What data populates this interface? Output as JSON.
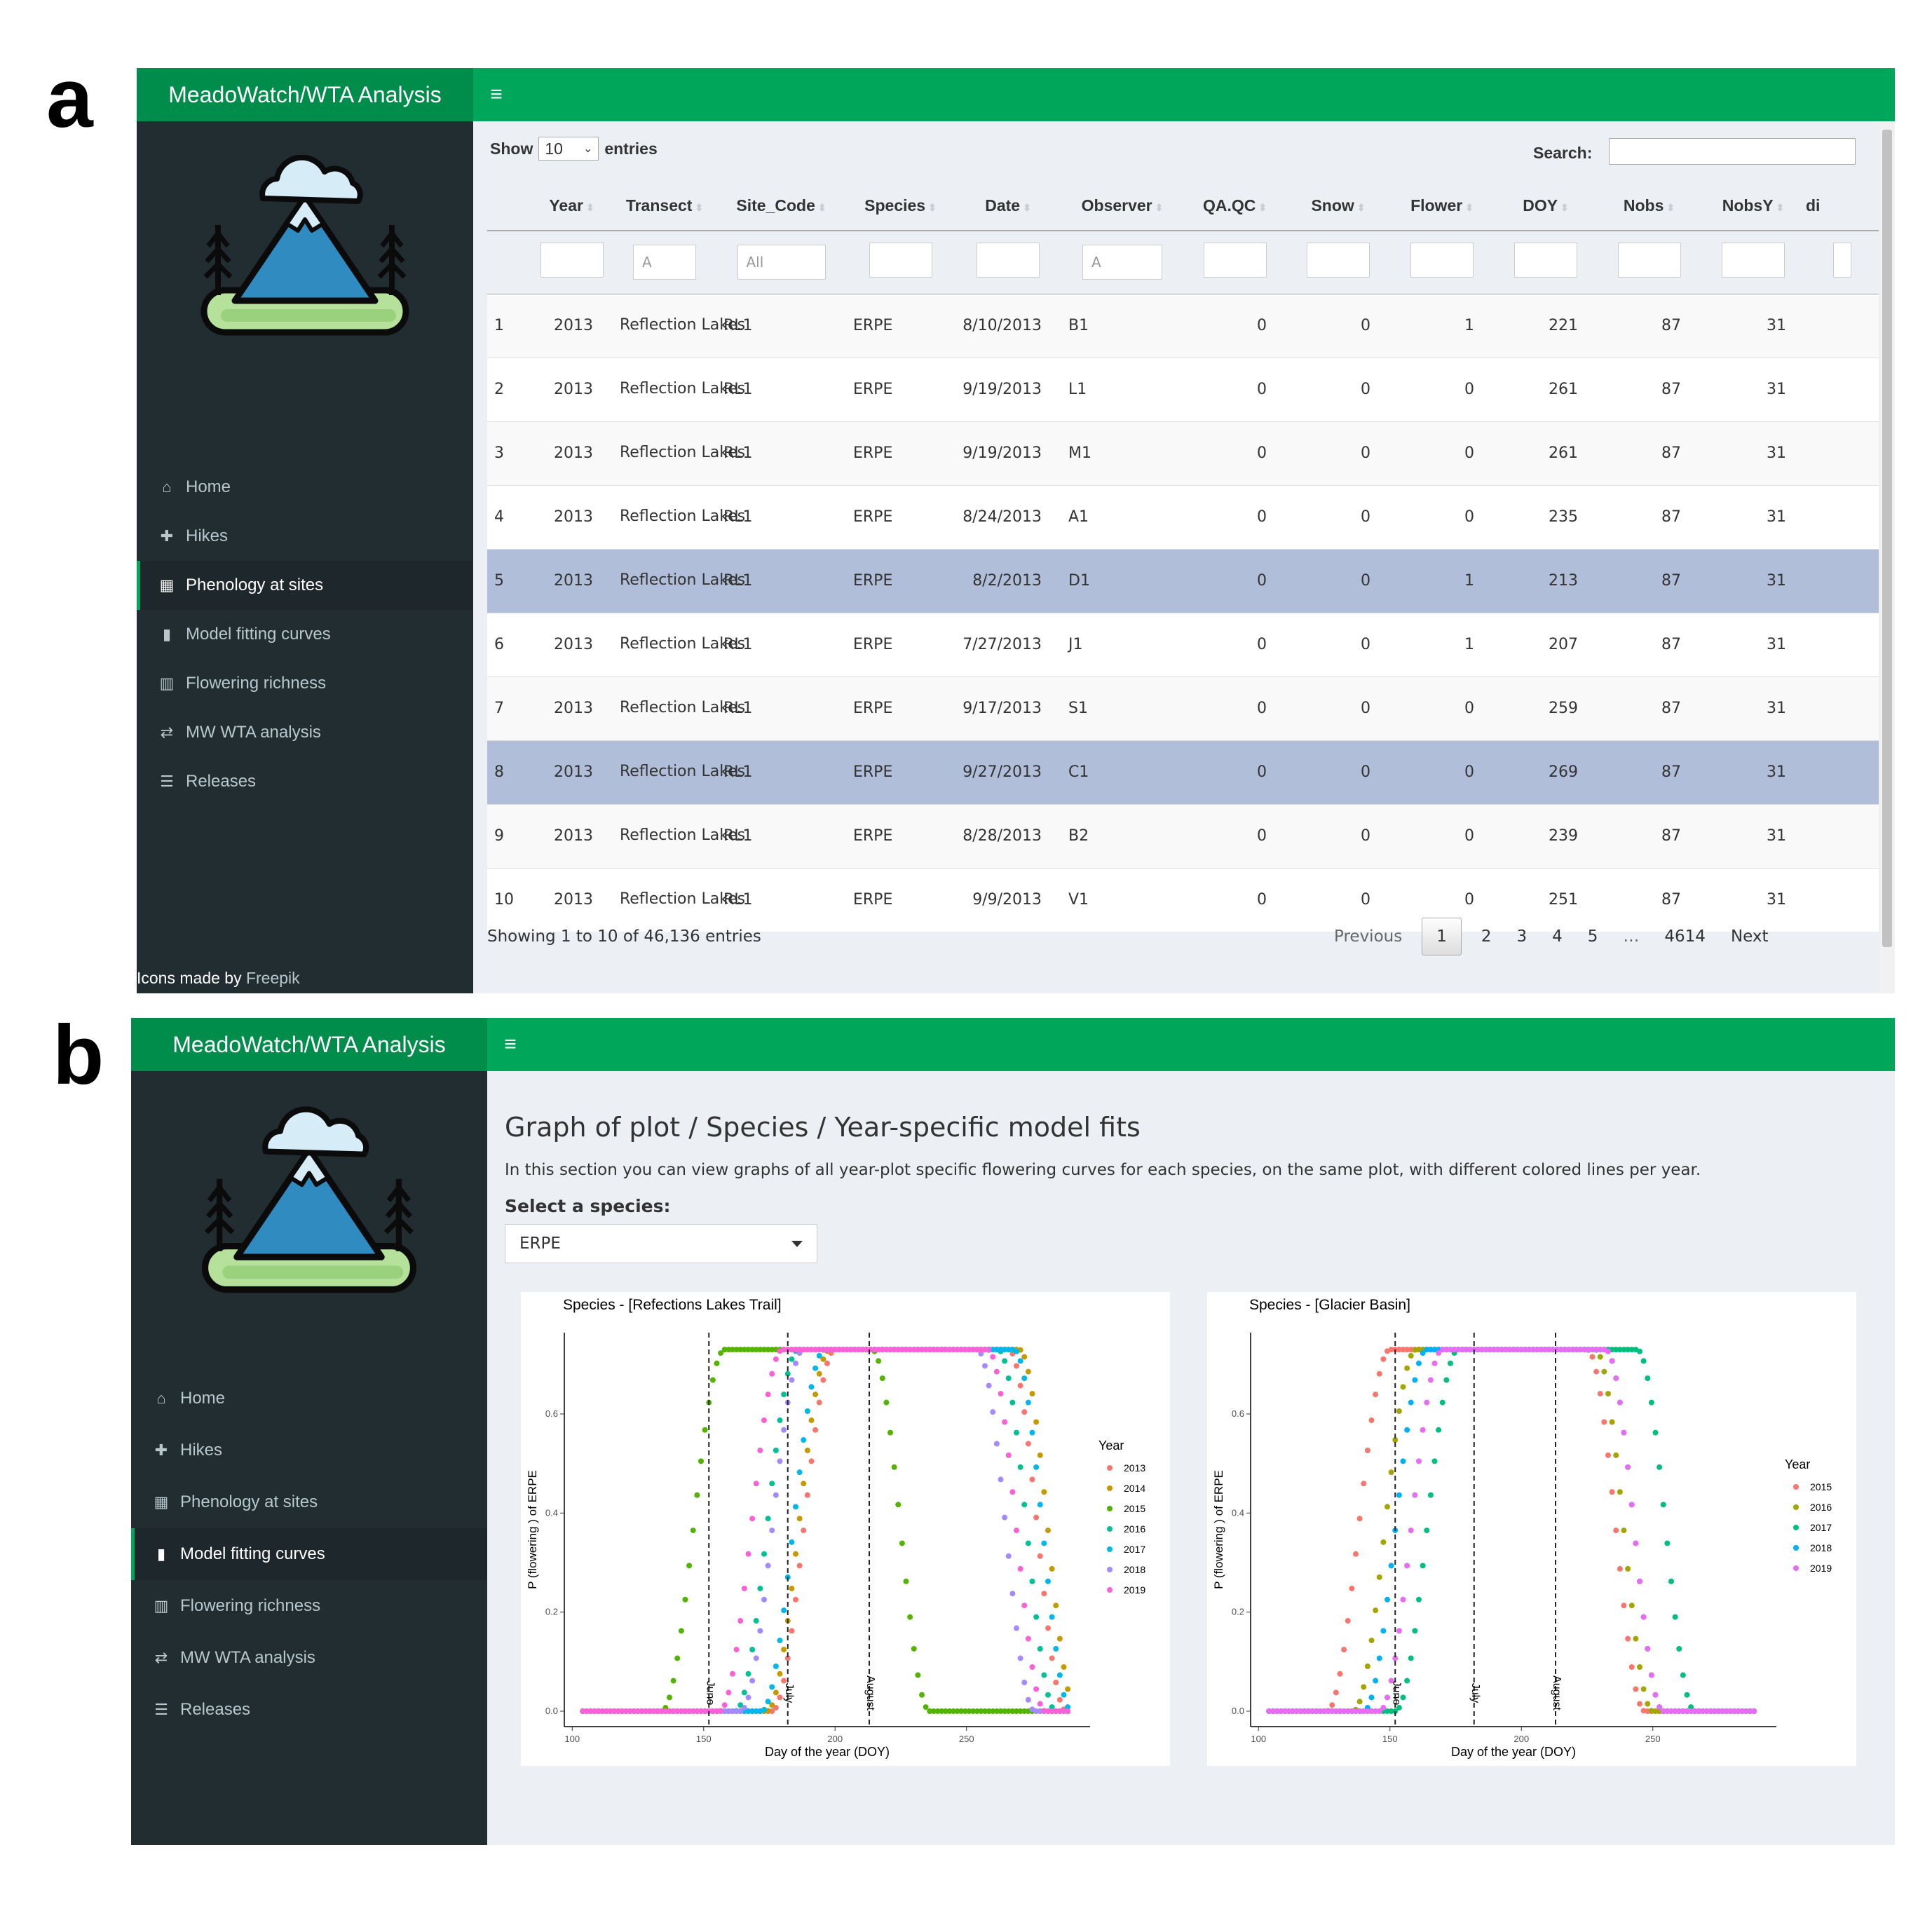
{
  "panels": {
    "a": "a",
    "b": "b"
  },
  "app": {
    "brand": "MeadoWatch/WTA Analysis"
  },
  "menu": [
    {
      "label": "Home",
      "icon": "home-icon"
    },
    {
      "label": "Hikes",
      "icon": "pin-icon"
    },
    {
      "label": "Phenology at sites",
      "icon": "table-icon"
    },
    {
      "label": "Model fitting curves",
      "icon": "bar-chart-icon"
    },
    {
      "label": "Flowering richness",
      "icon": "map-icon"
    },
    {
      "label": "MW WTA analysis",
      "icon": "random-icon"
    },
    {
      "label": "Releases",
      "icon": "list-icon"
    }
  ],
  "panel_a": {
    "active_menu": "Phenology at sites",
    "credit": {
      "prefix": "Icons made by ",
      "link": "Freepik"
    },
    "length": {
      "show": "Show",
      "value": "10",
      "entries": "entries"
    },
    "search_label": "Search:",
    "columns": [
      "",
      "Year",
      "Transect",
      "Site_Code",
      "Species",
      "Date",
      "Observer",
      "QA.QC",
      "Snow",
      "Flower",
      "DOY",
      "Nobs",
      "NobsY",
      "di"
    ],
    "filters": [
      "",
      "",
      "A",
      "All",
      "",
      "",
      "A",
      "",
      "",
      "",
      "",
      "",
      "",
      ""
    ],
    "rows": [
      [
        "1",
        "2013",
        "Reflection Lakes",
        "RL1",
        "ERPE",
        "8/10/2013",
        "B1",
        "0",
        "0",
        "1",
        "221",
        "87",
        "31"
      ],
      [
        "2",
        "2013",
        "Reflection Lakes",
        "RL1",
        "ERPE",
        "9/19/2013",
        "L1",
        "0",
        "0",
        "0",
        "261",
        "87",
        "31"
      ],
      [
        "3",
        "2013",
        "Reflection Lakes",
        "RL1",
        "ERPE",
        "9/19/2013",
        "M1",
        "0",
        "0",
        "0",
        "261",
        "87",
        "31"
      ],
      [
        "4",
        "2013",
        "Reflection Lakes",
        "RL1",
        "ERPE",
        "8/24/2013",
        "A1",
        "0",
        "0",
        "0",
        "235",
        "87",
        "31"
      ],
      [
        "5",
        "2013",
        "Reflection Lakes",
        "RL1",
        "ERPE",
        "8/2/2013",
        "D1",
        "0",
        "0",
        "1",
        "213",
        "87",
        "31"
      ],
      [
        "6",
        "2013",
        "Reflection Lakes",
        "RL1",
        "ERPE",
        "7/27/2013",
        "J1",
        "0",
        "0",
        "1",
        "207",
        "87",
        "31"
      ],
      [
        "7",
        "2013",
        "Reflection Lakes",
        "RL1",
        "ERPE",
        "9/17/2013",
        "S1",
        "0",
        "0",
        "0",
        "259",
        "87",
        "31"
      ],
      [
        "8",
        "2013",
        "Reflection Lakes",
        "RL1",
        "ERPE",
        "9/27/2013",
        "C1",
        "0",
        "0",
        "0",
        "269",
        "87",
        "31"
      ],
      [
        "9",
        "2013",
        "Reflection Lakes",
        "RL1",
        "ERPE",
        "8/28/2013",
        "B2",
        "0",
        "0",
        "0",
        "239",
        "87",
        "31"
      ],
      [
        "10",
        "2013",
        "Reflection Lakes",
        "RL1",
        "ERPE",
        "9/9/2013",
        "V1",
        "0",
        "0",
        "0",
        "251",
        "87",
        "31"
      ]
    ],
    "selected_rows": [
      5,
      8
    ],
    "info": "Showing 1 to 10 of 46,136 entries",
    "pagination": {
      "previous": "Previous",
      "pages": [
        "1",
        "2",
        "3",
        "4",
        "5",
        "…",
        "4614"
      ],
      "current": "1",
      "next": "Next"
    }
  },
  "panel_b": {
    "active_menu": "Model fitting curves",
    "heading": "Graph of plot / Species / Year-specific model fits",
    "description": "In this section you can view graphs of all year-plot specific flowering curves for each species, on the same plot, with different colored lines per year.",
    "select_label": "Select a species:",
    "select_value": "ERPE"
  },
  "colors": {
    "green": "#00a65a",
    "brand_green": "#008d4c",
    "sidebar": "#222d32",
    "selected_row": "#b0bed9"
  },
  "chart_data": [
    {
      "type": "scatter",
      "title": "Species - [Refections Lakes Trail]",
      "xlabel": "Day of the year (DOY)",
      "ylabel": "P (flowering ) of ERPE",
      "xlim": [
        100,
        290
      ],
      "ylim": [
        0,
        0.72
      ],
      "xticks": [
        100,
        150,
        200,
        250
      ],
      "yticks": [
        0.0,
        0.2,
        0.4,
        0.6
      ],
      "grid": false,
      "legend": {
        "title": "Year",
        "placement": "right"
      },
      "vlines": [
        {
          "x": 152,
          "label": "June"
        },
        {
          "x": 182,
          "label": "July"
        },
        {
          "x": 213,
          "label": "August"
        }
      ],
      "series": [
        {
          "name": "2013",
          "color": "#F8766D",
          "start": 200,
          "end": 266
        },
        {
          "name": "2014",
          "color": "#C49A00",
          "start": 198,
          "end": 270
        },
        {
          "name": "2015",
          "color": "#53B400",
          "start": 158,
          "end": 214
        },
        {
          "name": "2016",
          "color": "#00C094",
          "start": 186,
          "end": 262
        },
        {
          "name": "2017",
          "color": "#00B6EB",
          "start": 196,
          "end": 268
        },
        {
          "name": "2018",
          "color": "#A58AFF",
          "start": 188,
          "end": 254
        },
        {
          "name": "2019",
          "color": "#FB61D7",
          "start": 180,
          "end": 258
        }
      ],
      "x_range": [
        104,
        289
      ],
      "plateau": 0.73
    },
    {
      "type": "scatter",
      "title": "Species - [Glacier Basin]",
      "xlabel": "Day of the year (DOY)",
      "ylabel": "P (flowering ) of ERPE",
      "xlim": [
        100,
        290
      ],
      "ylim": [
        0,
        0.72
      ],
      "xticks": [
        100,
        150,
        200,
        250
      ],
      "yticks": [
        0.0,
        0.2,
        0.4,
        0.6
      ],
      "grid": false,
      "legend": {
        "title": "Year",
        "placement": "right"
      },
      "vlines": [
        {
          "x": 152,
          "label": "June"
        },
        {
          "x": 182,
          "label": "July"
        },
        {
          "x": 213,
          "label": "August"
        }
      ],
      "series": [
        {
          "name": "2015",
          "color": "#F8766D",
          "start": 150,
          "end": 225
        },
        {
          "name": "2016",
          "color": "#A3A500",
          "start": 160,
          "end": 228
        },
        {
          "name": "2017",
          "color": "#00BF7D",
          "start": 176,
          "end": 244
        },
        {
          "name": "2018",
          "color": "#00B0F6",
          "start": 164,
          "end": 232
        },
        {
          "name": "2019",
          "color": "#E76BF3",
          "start": 170,
          "end": 232
        }
      ],
      "x_range": [
        104,
        289
      ],
      "plateau": 0.73
    }
  ]
}
